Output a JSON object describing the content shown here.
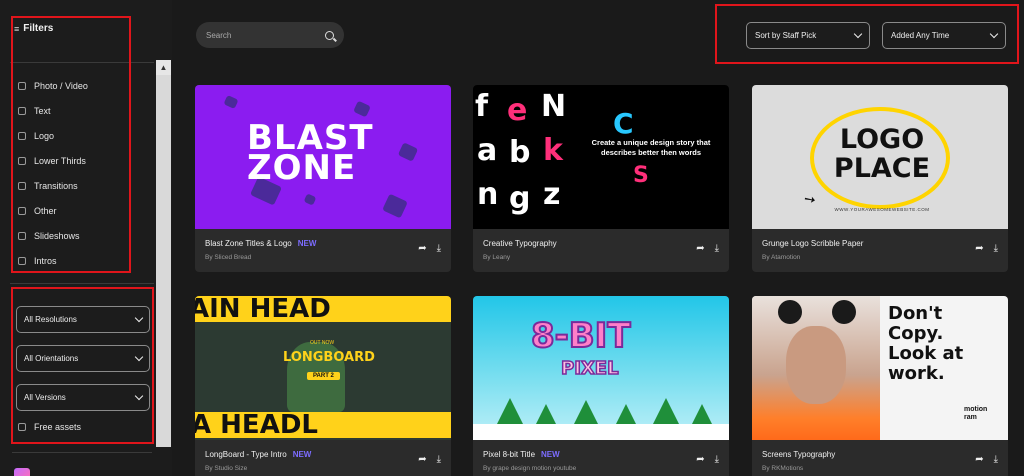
{
  "sidebar": {
    "filters_label": "Filters",
    "categories": [
      {
        "label": "Photo / Video"
      },
      {
        "label": "Text"
      },
      {
        "label": "Logo"
      },
      {
        "label": "Lower Thirds"
      },
      {
        "label": "Transitions"
      },
      {
        "label": "Other"
      },
      {
        "label": "Slideshows"
      },
      {
        "label": "Intros"
      }
    ],
    "resolutions": "All Resolutions",
    "orientations": "All Orientations",
    "versions": "All Versions",
    "free_assets": "Free assets"
  },
  "search": {
    "placeholder": "Search"
  },
  "sort": {
    "sort_by": "Sort by Staff Pick",
    "added": "Added Any Time"
  },
  "cards": [
    {
      "title": "Blast Zone Titles & Logo",
      "badge": "NEW",
      "author": "By Sliced Bread",
      "thumb_text": "BLAST ZONE"
    },
    {
      "title": "Creative Typography",
      "badge": "",
      "author": "By Leany",
      "thumb_text": "Create a unique design story that describes better then words"
    },
    {
      "title": "Grunge Logo Scribble Paper",
      "badge": "",
      "author": "By Atamotion",
      "thumb_text": "LOGO PLACE",
      "thumb_sub": "WWW.YOURAWESOMEWEBSITE.COM"
    },
    {
      "title": "LongBoard - Type Intro",
      "badge": "NEW",
      "author": "By Studio Size",
      "thumb_text": "LONGBOARD",
      "thumb_part": "PART 2",
      "thumb_out": "OUT NOW"
    },
    {
      "title": "Pixel 8-bit Title",
      "badge": "NEW",
      "author": "By grape design motion youtube",
      "thumb_text": "8-BIT",
      "thumb_sub": "PIXEL"
    },
    {
      "title": "Screens Typography",
      "badge": "",
      "author": "By RKMotions",
      "thumb_text": "Don't Copy. Look at work.",
      "thumb_brand": "motion ram"
    }
  ],
  "colors": {
    "accent_new": "#7c6cff",
    "highlight": "#e0151b",
    "background": "#1a1a1a",
    "card": "#2b2b2b"
  }
}
